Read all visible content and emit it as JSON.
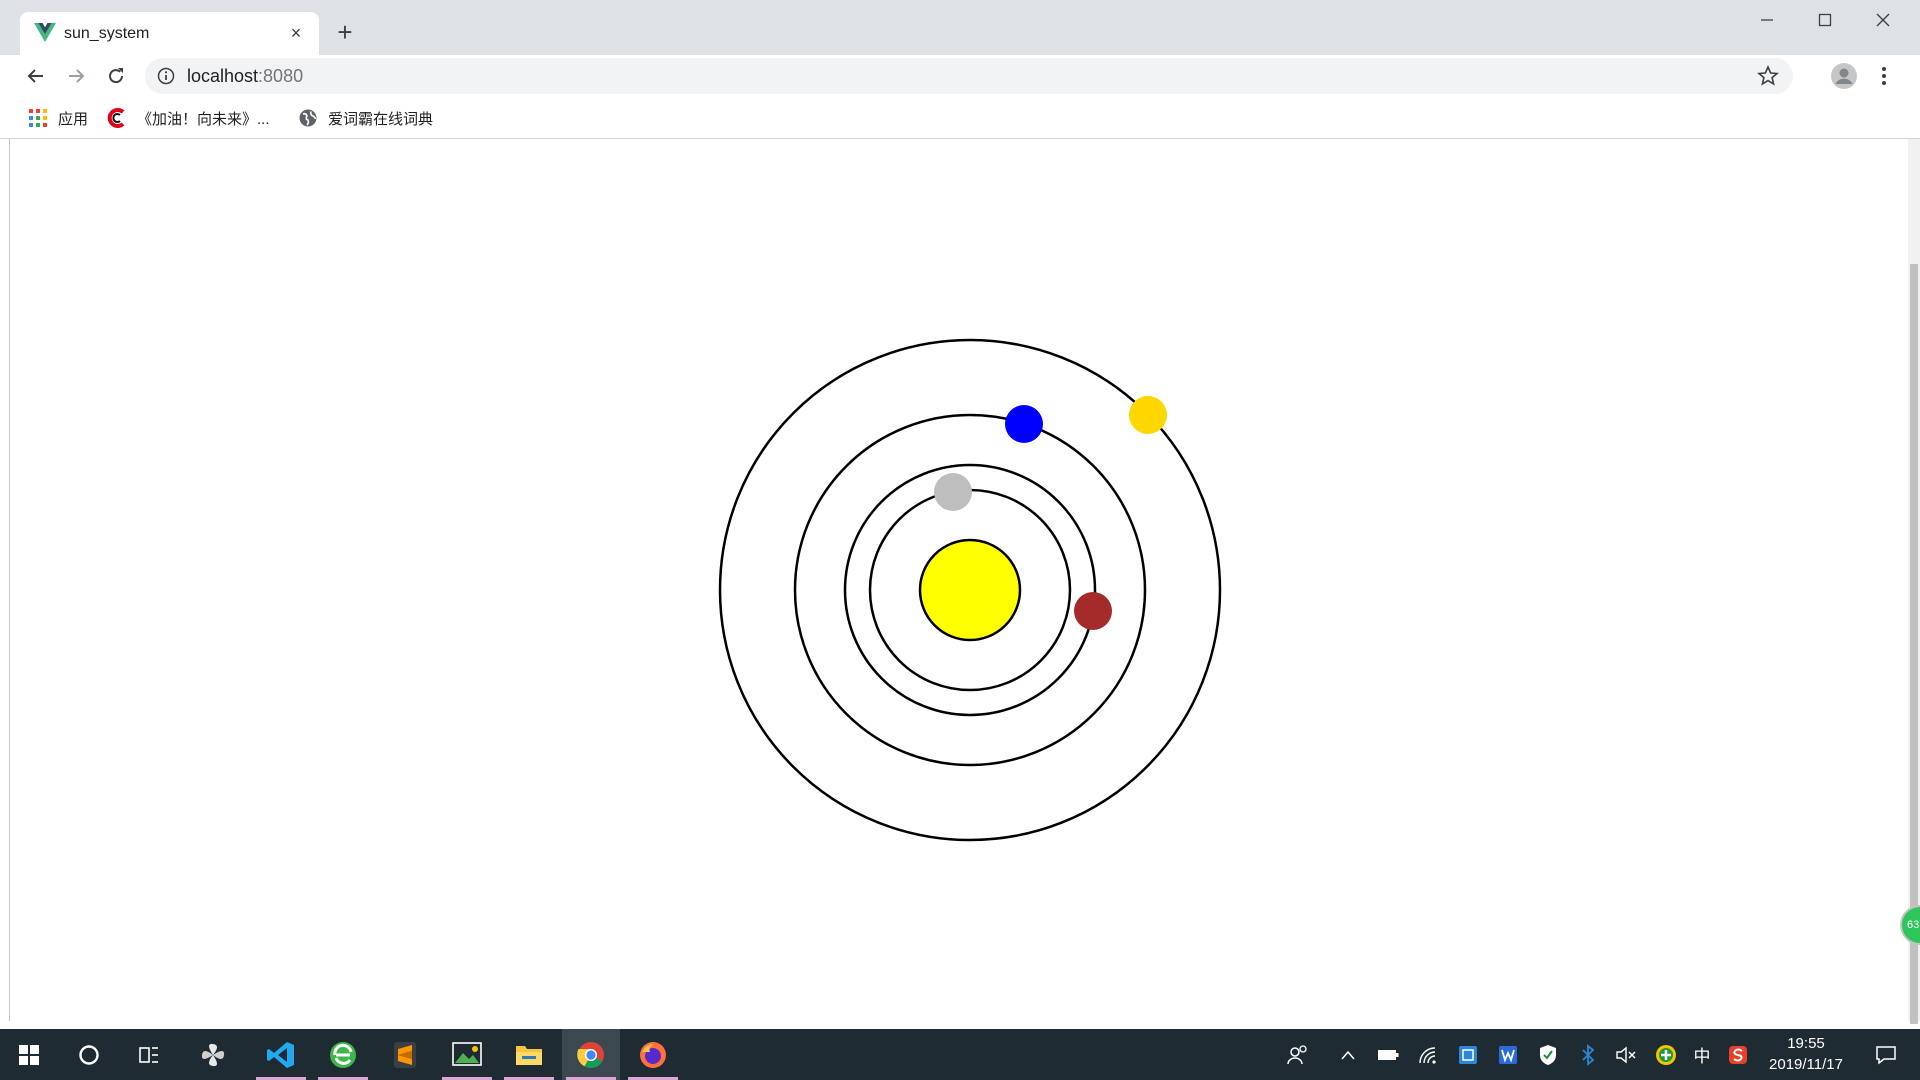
{
  "tab": {
    "title": "sun_system",
    "close_symbol": "×",
    "favicon": "vue-logo-icon"
  },
  "new_tab_symbol": "+",
  "omnibox": {
    "host": "localhost",
    "port": ":8080"
  },
  "bookmarks": [
    {
      "label": "应用",
      "icon": "apps-grid-icon"
    },
    {
      "label": "《加油！向未来》...",
      "icon": "c-logo-icon"
    },
    {
      "label": "爱词霸在线词典",
      "icon": "globe-icon"
    }
  ],
  "solar_system": {
    "sun_color": "#ffff00",
    "orbit_color": "#000000",
    "planet_colors": [
      "#bebebe",
      "#a52a2a",
      "#0000ff",
      "#ffd700"
    ]
  },
  "taskbar": {
    "apps": [
      "start-icon",
      "cortana-icon",
      "task-view-icon",
      "pinwheel-icon",
      "vscode-icon",
      "browser-360-icon",
      "sublime-icon",
      "image-tool-icon",
      "file-explorer-icon",
      "chrome-icon",
      "firefox-icon"
    ],
    "tray_ime": "中",
    "time": "19:55",
    "date": "2019/11/17"
  },
  "float_badge": "63"
}
